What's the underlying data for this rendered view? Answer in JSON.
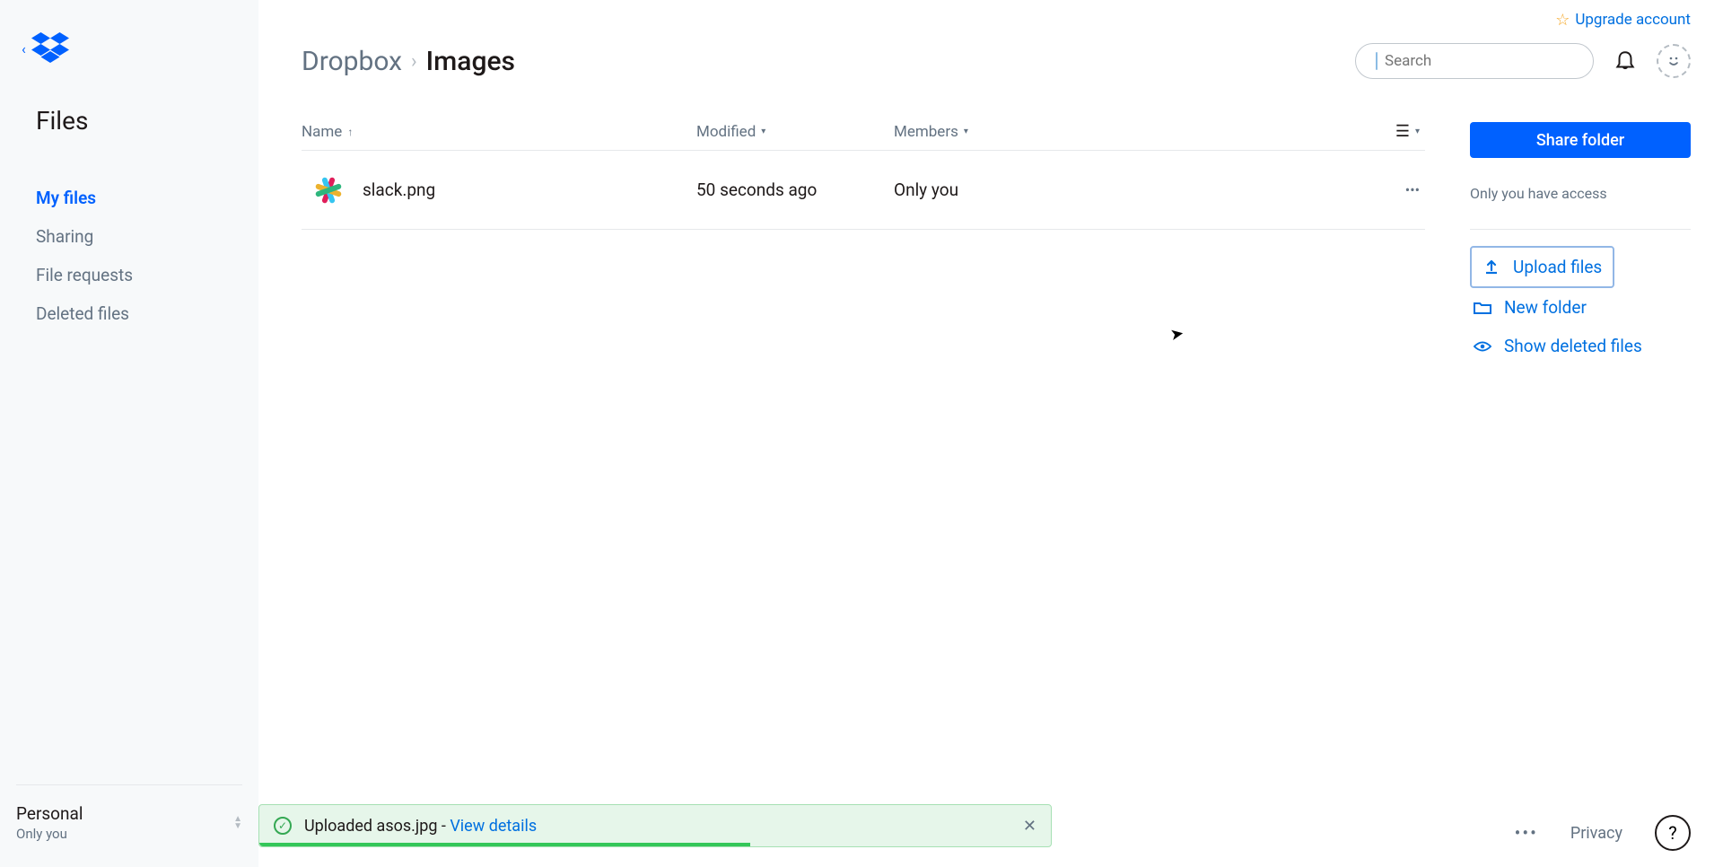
{
  "topbar": {
    "upgrade": "Upgrade account"
  },
  "sidebar": {
    "section": "Files",
    "nav": {
      "myfiles": "My files",
      "sharing": "Sharing",
      "requests": "File requests",
      "deleted": "Deleted files"
    },
    "account": {
      "name": "Personal",
      "sub": "Only you"
    }
  },
  "breadcrumb": {
    "root": "Dropbox",
    "current": "Images"
  },
  "search": {
    "placeholder": "Search"
  },
  "table": {
    "cols": {
      "name": "Name",
      "modified": "Modified",
      "members": "Members"
    },
    "rows": [
      {
        "name": "slack.png",
        "modified": "50 seconds ago",
        "members": "Only you"
      }
    ]
  },
  "side": {
    "share": "Share folder",
    "access": "Only you have access",
    "upload": "Upload files",
    "newfolder": "New folder",
    "showdeleted": "Show deleted files"
  },
  "toast": {
    "text": "Uploaded asos.jpg - ",
    "link": "View details"
  },
  "footer": {
    "privacy": "Privacy"
  }
}
